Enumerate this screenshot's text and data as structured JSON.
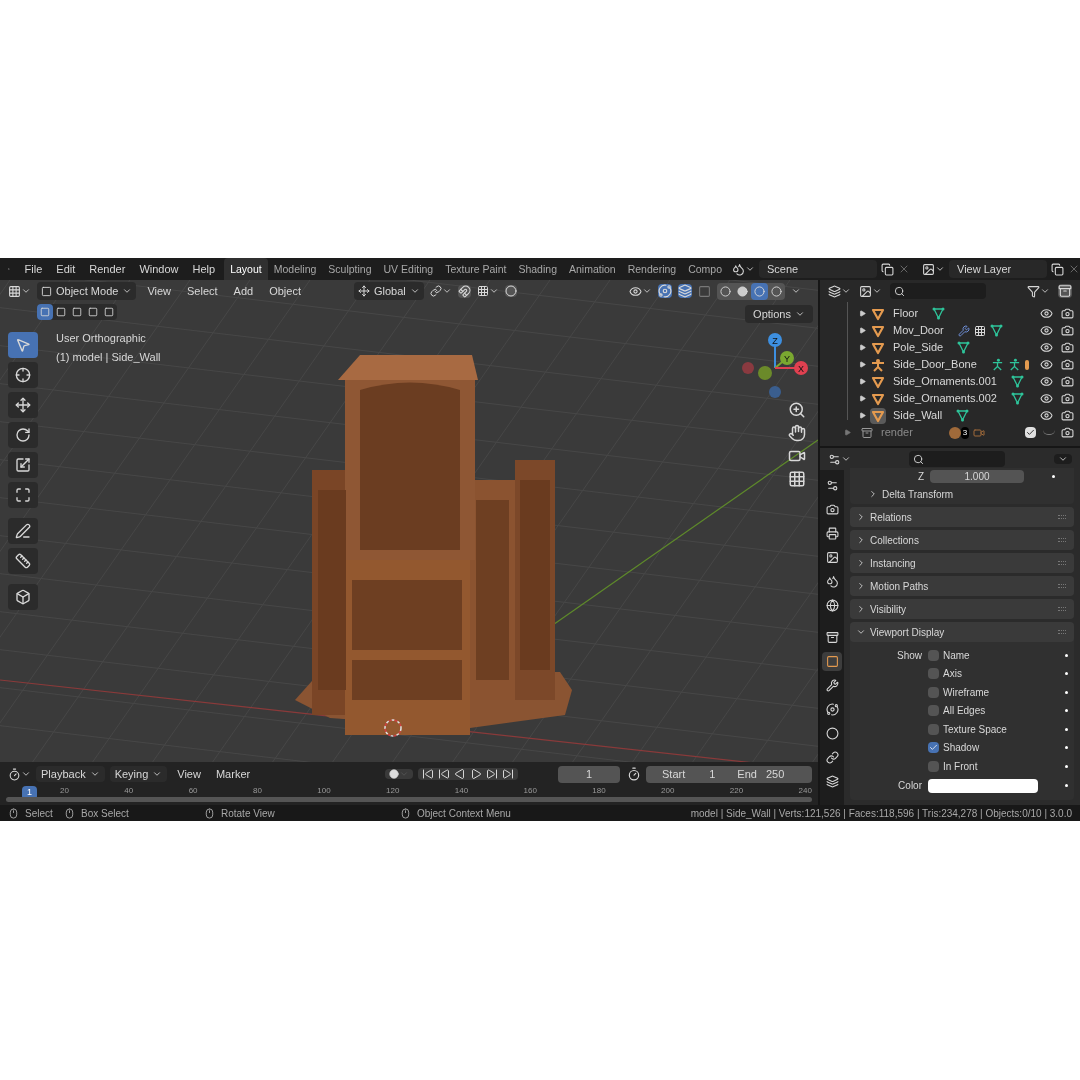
{
  "topbar": {
    "menus": [
      "File",
      "Edit",
      "Render",
      "Window",
      "Help"
    ],
    "workspaces": [
      {
        "label": "Layout",
        "selected": true
      },
      {
        "label": "Modeling",
        "selected": false
      },
      {
        "label": "Sculpting",
        "selected": false
      },
      {
        "label": "UV Editing",
        "selected": false
      },
      {
        "label": "Texture Paint",
        "selected": false
      },
      {
        "label": "Shading",
        "selected": false
      },
      {
        "label": "Animation",
        "selected": false
      },
      {
        "label": "Rendering",
        "selected": false
      },
      {
        "label": "Compo",
        "selected": false
      }
    ],
    "scene": "Scene",
    "view_layer": "View Layer"
  },
  "viewport": {
    "mode": "Object Mode",
    "menus": [
      "View",
      "Select",
      "Add",
      "Object"
    ],
    "orientation": "Global",
    "select_modes": [
      {
        "selected": true
      },
      {
        "selected": false
      },
      {
        "selected": false
      },
      {
        "selected": false
      },
      {
        "selected": false
      }
    ],
    "shading_modes": [
      {
        "selected": false
      },
      {
        "selected": false
      },
      {
        "selected": true
      },
      {
        "selected": false
      }
    ],
    "options": "Options",
    "info": [
      "User Orthographic",
      "(1) model | Side_Wall"
    ],
    "tools": [
      {
        "selected": true
      },
      {
        "selected": false
      },
      {
        "selected": false
      },
      {
        "selected": false
      },
      {
        "selected": false
      },
      {
        "selected": false
      },
      {
        "selected": false
      },
      {
        "selected": false
      },
      {
        "selected": false
      }
    ],
    "axes": [
      "Z",
      "Y",
      "X"
    ]
  },
  "timeline": {
    "menus": [
      "Playback",
      "Keying",
      "View",
      "Marker"
    ],
    "current_frame": "1",
    "start_label": "Start",
    "start": "1",
    "end_label": "End",
    "end": "250",
    "frame_badge": "1",
    "ruler": [
      "20",
      "40",
      "60",
      "80",
      "100",
      "120",
      "140",
      "160",
      "180",
      "200",
      "220",
      "240"
    ]
  },
  "outliner": {
    "items": [
      {
        "name": "Floor",
        "kind": "mesh",
        "active": false,
        "modifier": false
      },
      {
        "name": "Mov_Door",
        "kind": "mesh",
        "active": false,
        "modifier": true
      },
      {
        "name": "Pole_Side",
        "kind": "mesh",
        "active": false,
        "modifier": false
      },
      {
        "name": "Side_Door_Bone",
        "kind": "armature",
        "active": false,
        "modifier": false
      },
      {
        "name": "Side_Ornaments.001",
        "kind": "mesh",
        "active": false,
        "modifier": false
      },
      {
        "name": "Side_Ornaments.002",
        "kind": "mesh",
        "active": false,
        "modifier": false
      },
      {
        "name": "Side_Wall",
        "kind": "mesh",
        "active": true,
        "modifier": false
      }
    ],
    "collection": {
      "name": "render",
      "count": "3",
      "checked": true
    }
  },
  "properties": {
    "tabs": [
      {
        "selected": false
      },
      {
        "selected": false
      },
      {
        "selected": false
      },
      {
        "selected": false
      },
      {
        "selected": false
      },
      {
        "selected": false
      },
      {
        "selected": false
      },
      {
        "selected": true
      },
      {
        "selected": false
      },
      {
        "selected": false
      },
      {
        "selected": false
      },
      {
        "selected": false
      },
      {
        "selected": false
      }
    ],
    "z_label": "Z",
    "z_value": "1.000",
    "subpanel": {
      "label": "Delta Transform",
      "expanded": false
    },
    "panels": [
      {
        "label": "Relations",
        "expanded": false
      },
      {
        "label": "Collections",
        "expanded": false
      },
      {
        "label": "Instancing",
        "expanded": false
      },
      {
        "label": "Motion Paths",
        "expanded": false
      },
      {
        "label": "Visibility",
        "expanded": false
      },
      {
        "label": "Viewport Display",
        "expanded": true
      }
    ],
    "show_label": "Show",
    "checkboxes": [
      {
        "label": "Name",
        "checked": false
      },
      {
        "label": "Axis",
        "checked": false
      },
      {
        "label": "Wireframe",
        "checked": false
      },
      {
        "label": "All Edges",
        "checked": false
      },
      {
        "label": "Texture Space",
        "checked": false
      },
      {
        "label": "Shadow",
        "checked": true
      },
      {
        "label": "In Front",
        "checked": false
      }
    ],
    "color_label": "Color",
    "color": "#ffffff"
  },
  "status": {
    "hints": [
      "Select",
      "Box Select",
      "Rotate View",
      "Object Context Menu"
    ],
    "stats": "model | Side_Wall | Verts:121,526 | Faces:118,596 | Tris:234,278 | Objects:0/10 | 3.0.0"
  }
}
